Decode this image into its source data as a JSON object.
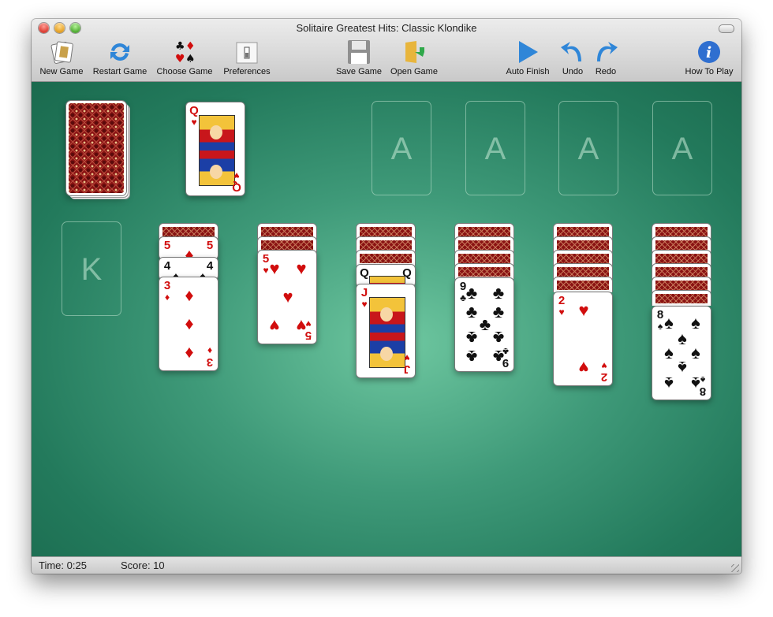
{
  "window": {
    "title": "Solitaire Greatest Hits: Classic Klondike"
  },
  "toolbar": [
    {
      "id": "new-game",
      "label": "New Game",
      "icon": "new-game-icon"
    },
    {
      "id": "restart-game",
      "label": "Restart Game",
      "icon": "restart-icon"
    },
    {
      "id": "choose-game",
      "label": "Choose Game",
      "icon": "card-suits-icon"
    },
    {
      "id": "preferences",
      "label": "Preferences",
      "icon": "preferences-switch-icon"
    },
    {
      "id": "save-game",
      "label": "Save Game",
      "icon": "floppy-disk-icon"
    },
    {
      "id": "open-game",
      "label": "Open Game",
      "icon": "folder-open-icon"
    },
    {
      "id": "auto-finish",
      "label": "Auto Finish",
      "icon": "play-icon"
    },
    {
      "id": "undo",
      "label": "Undo",
      "icon": "undo-arrow-icon"
    },
    {
      "id": "redo",
      "label": "Redo",
      "icon": "redo-arrow-icon"
    },
    {
      "id": "how-to-play",
      "label": "How To Play",
      "icon": "info-icon"
    }
  ],
  "colors": {
    "felt": "#3f9a79",
    "card_red": "#d10d0d",
    "card_black": "#111111",
    "back": "#8a1313"
  },
  "stock": {
    "state": "face-down"
  },
  "waste": {
    "rank": "Q",
    "suit": "♥",
    "color": "red"
  },
  "foundations": [
    {
      "placeholder": "A"
    },
    {
      "placeholder": "A"
    },
    {
      "placeholder": "A"
    },
    {
      "placeholder": "A"
    }
  ],
  "tableau": [
    {
      "placeholder": "K",
      "hidden": 0,
      "visible": []
    },
    {
      "hidden": 1,
      "visible": [
        {
          "rank": "5",
          "suit": "♦",
          "color": "red"
        },
        {
          "rank": "4",
          "suit": "♠",
          "color": "black"
        },
        {
          "rank": "3",
          "suit": "♦",
          "color": "red"
        }
      ]
    },
    {
      "hidden": 2,
      "visible": [
        {
          "rank": "5",
          "suit": "♥",
          "color": "red"
        }
      ]
    },
    {
      "hidden": 3,
      "visible": [
        {
          "rank": "Q",
          "suit": "♠",
          "color": "black"
        },
        {
          "rank": "J",
          "suit": "♥",
          "color": "red"
        }
      ]
    },
    {
      "hidden": 4,
      "visible": [
        {
          "rank": "9",
          "suit": "♣",
          "color": "black"
        }
      ]
    },
    {
      "hidden": 5,
      "visible": [
        {
          "rank": "2",
          "suit": "♥",
          "color": "red"
        }
      ]
    },
    {
      "hidden": 6,
      "visible": [
        {
          "rank": "8",
          "suit": "♠",
          "color": "black"
        }
      ]
    }
  ],
  "status": {
    "time": "Time: 0:25",
    "score": "Score: 10"
  }
}
